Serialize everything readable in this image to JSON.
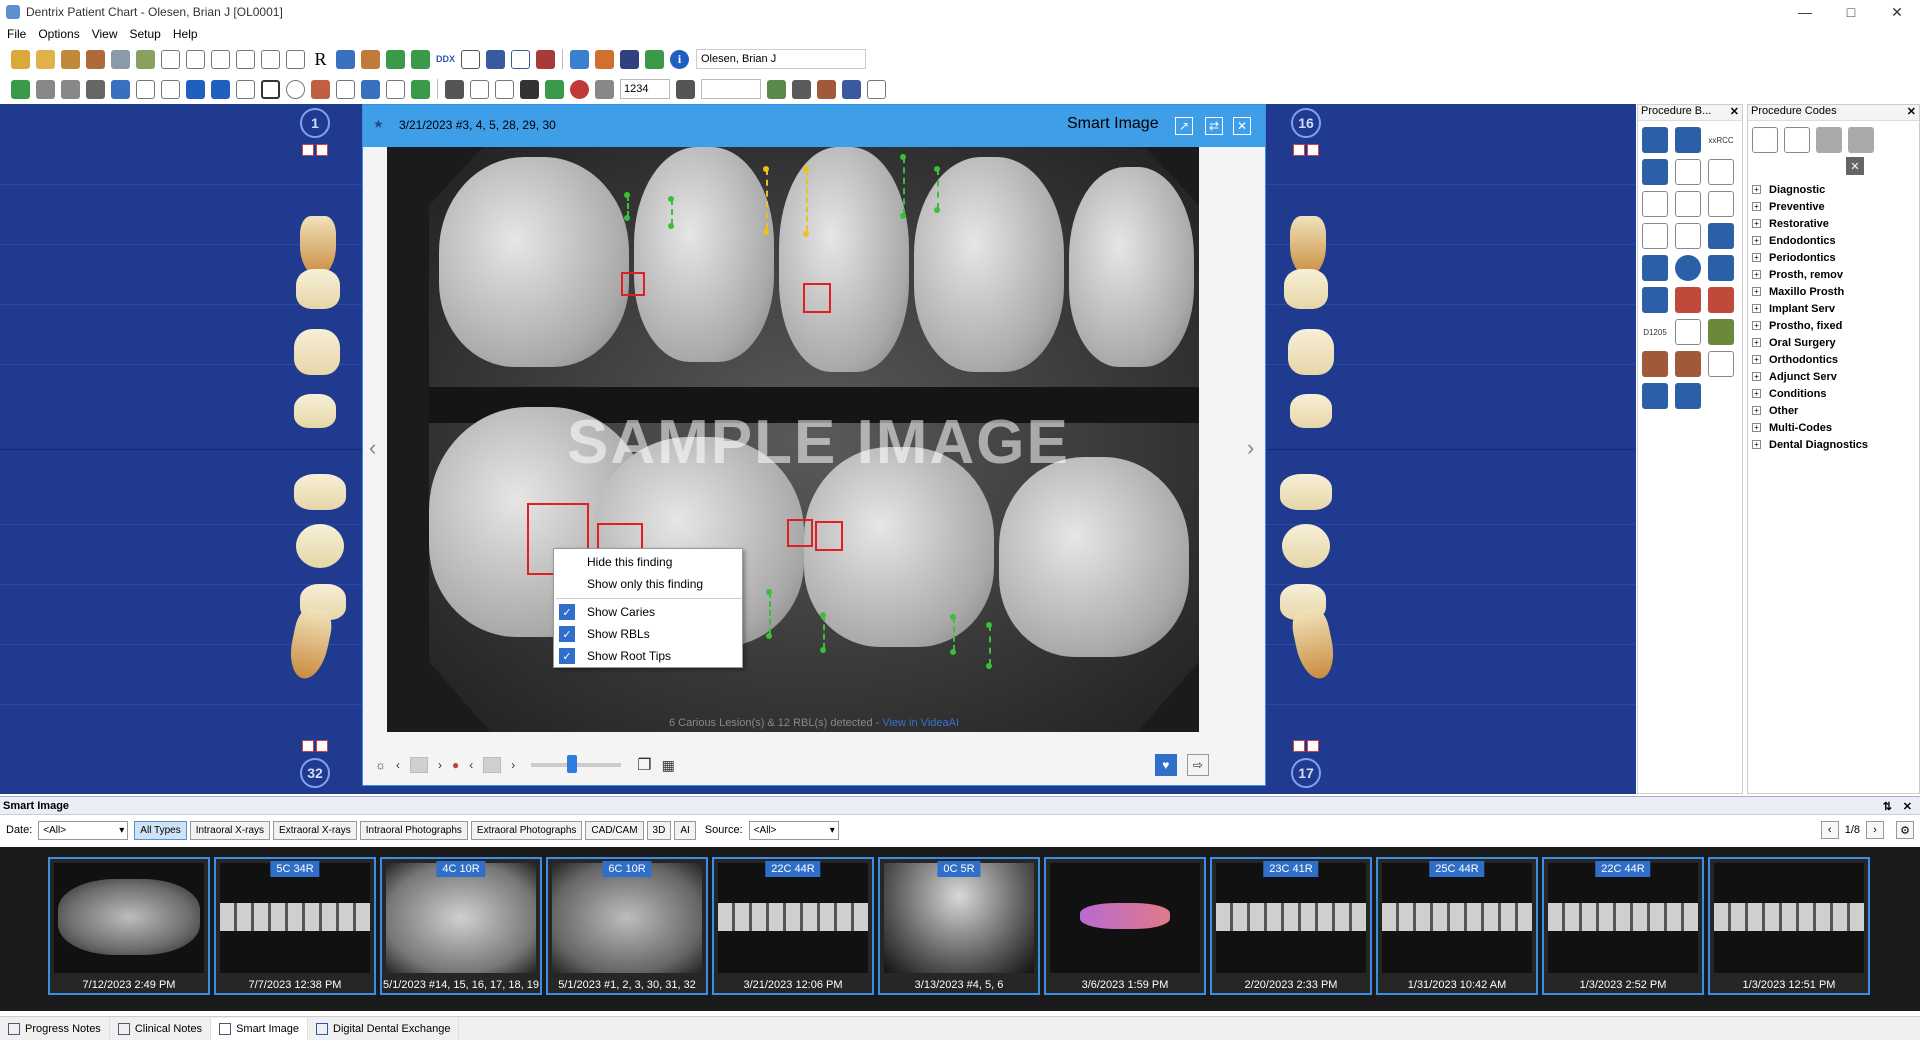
{
  "window": {
    "title": "Dentrix Patient Chart - Olesen, Brian J [OL0001]"
  },
  "menu": {
    "items": [
      "File",
      "Options",
      "View",
      "Setup",
      "Help"
    ]
  },
  "toolbar": {
    "patient": "Olesen, Brian J",
    "provider_code": "1234",
    "ddx_label": "DDX"
  },
  "chart": {
    "tooth_1": "1",
    "tooth_16": "16",
    "tooth_32": "32",
    "tooth_17": "17"
  },
  "smart_image_window": {
    "date_teeth": "3/21/2023 #3, 4, 5, 28, 29, 30",
    "title": "Smart Image",
    "watermark": "SAMPLE IMAGE",
    "detected_text": "6 Carious Lesion(s) & 12 RBL(s) detected - ",
    "detected_link": "View in VideaAI"
  },
  "context_menu": {
    "items": [
      {
        "label": "Hide this finding",
        "checked": false
      },
      {
        "label": "Show only this finding",
        "checked": false
      },
      {
        "label": "Show Caries",
        "checked": true
      },
      {
        "label": "Show RBLs",
        "checked": true
      },
      {
        "label": "Show Root Tips",
        "checked": true
      }
    ]
  },
  "procedure_buttons": {
    "title": "Procedure B...",
    "code_label_1": "xxRCC",
    "code_label_2": "D1205"
  },
  "procedure_codes": {
    "title": "Procedure Codes",
    "categories": [
      "Diagnostic",
      "Preventive",
      "Restorative",
      "Endodontics",
      "Periodontics",
      "Prosth, remov",
      "Maxillo Prosth",
      "Implant Serv",
      "Prostho, fixed",
      "Oral Surgery",
      "Orthodontics",
      "Adjunct Serv",
      "Conditions",
      "Other",
      "Multi-Codes",
      "Dental Diagnostics"
    ]
  },
  "smart_image_panel": {
    "title": "Smart Image",
    "date_label": "Date:",
    "date_value": "<All>",
    "source_label": "Source:",
    "source_value": "<All>",
    "type_buttons": [
      "All Types",
      "Intraoral X-rays",
      "Extraoral X-rays",
      "Intraoral Photographs",
      "Extraoral Photographs",
      "CAD/CAM",
      "3D",
      "AI"
    ],
    "page": "1/8",
    "thumbnails": [
      {
        "label": "7/12/2023 2:49 PM",
        "badge": ""
      },
      {
        "label": "7/7/2023 12:38 PM",
        "badge": "5C 34R"
      },
      {
        "label": "5/1/2023 #14, 15, 16, 17, 18, 19",
        "badge": "4C 10R"
      },
      {
        "label": "5/1/2023 #1, 2, 3, 30, 31, 32",
        "badge": "6C 10R"
      },
      {
        "label": "3/21/2023 12:06 PM",
        "badge": "22C 44R"
      },
      {
        "label": "3/13/2023 #4, 5, 6",
        "badge": "0C 5R"
      },
      {
        "label": "3/6/2023 1:59 PM",
        "badge": ""
      },
      {
        "label": "2/20/2023 2:33 PM",
        "badge": "23C 41R"
      },
      {
        "label": "1/31/2023 10:42 AM",
        "badge": "25C 44R"
      },
      {
        "label": "1/3/2023 2:52 PM",
        "badge": "22C 44R"
      },
      {
        "label": "1/3/2023 12:51 PM",
        "badge": ""
      }
    ]
  },
  "bottom_tabs": [
    "Progress Notes",
    "Clinical Notes",
    "Smart Image",
    "Digital Dental Exchange"
  ]
}
